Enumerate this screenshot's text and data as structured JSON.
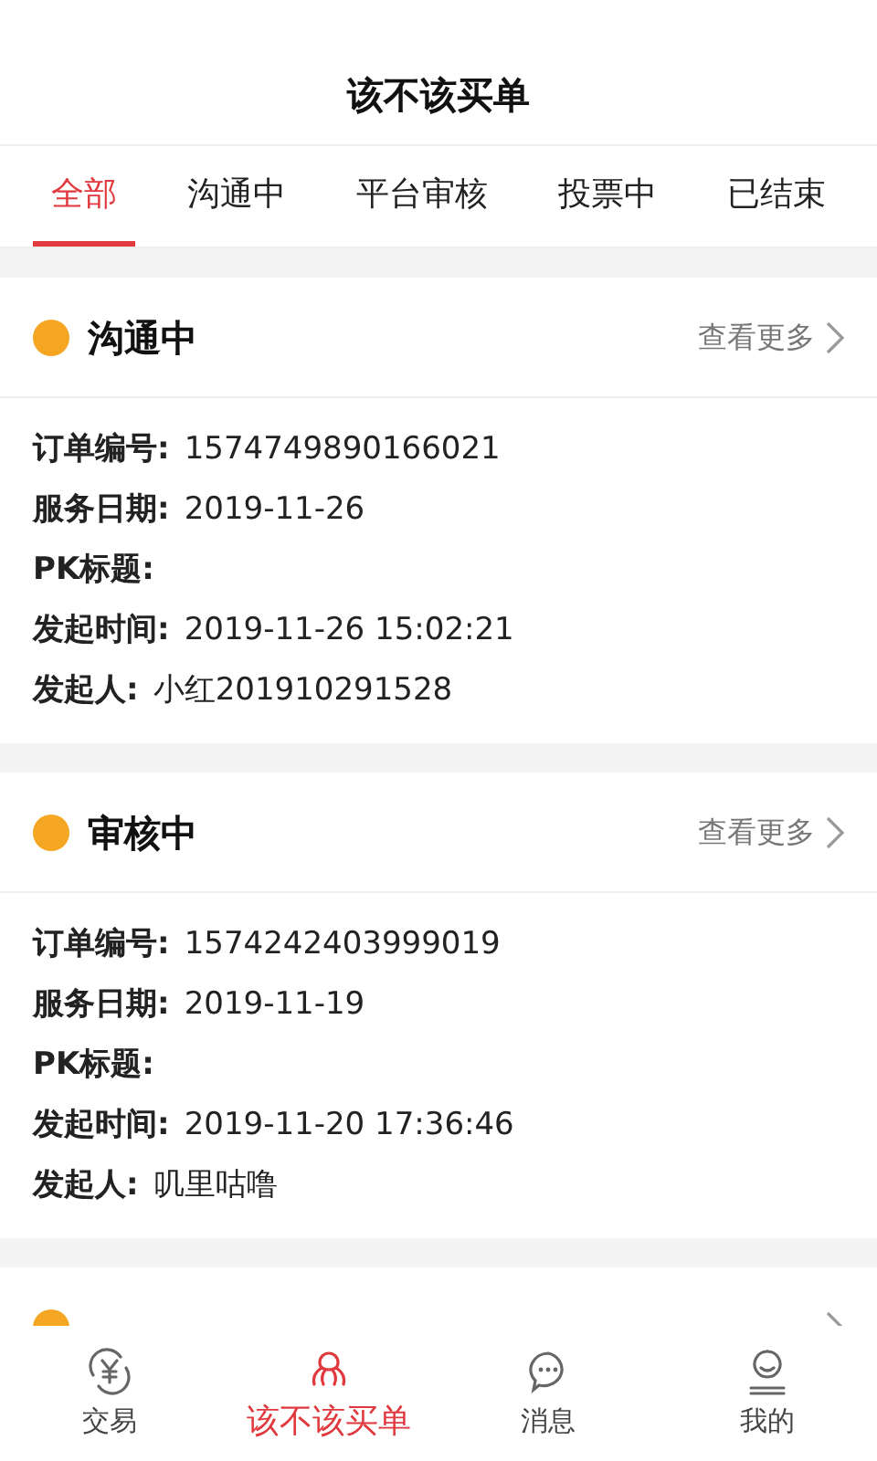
{
  "header": {
    "title": "该不该买单"
  },
  "tabs": [
    {
      "label": "全部",
      "selected": true
    },
    {
      "label": "沟通中",
      "selected": false
    },
    {
      "label": "平台审核",
      "selected": false
    },
    {
      "label": "投票中",
      "selected": false
    },
    {
      "label": "已结束",
      "selected": false
    }
  ],
  "cards": [
    {
      "status": "沟通中",
      "color": "#f5a623",
      "more": "查看更多",
      "fields": [
        {
          "label": "订单编号:",
          "value": "1574749890166021"
        },
        {
          "label": "服务日期:",
          "value": "2019-11-26"
        },
        {
          "label": "PK标题:"
        },
        {
          "label": "发起时间:",
          "value": "2019-11-26 15:02:21"
        },
        {
          "label": "发起人:",
          "value": "小红201910291528"
        }
      ]
    },
    {
      "status": "审核中",
      "color": "#f5a623",
      "more": "查看更多",
      "fields": [
        {
          "label": "订单编号:",
          "value": "1574242403999019"
        },
        {
          "label": "服务日期:",
          "value": "2019-11-19"
        },
        {
          "label": "PK标题:"
        },
        {
          "label": "发起时间:",
          "value": "2019-11-20 17:36:46"
        },
        {
          "label": "发起人:",
          "value": "叽里咕噜"
        }
      ]
    },
    {
      "color": "#f5a623"
    }
  ],
  "nav": [
    {
      "label": "交易",
      "selected": false
    },
    {
      "label": "该不该买单",
      "selected": true
    },
    {
      "label": "消息",
      "selected": false
    },
    {
      "label": "我的",
      "selected": false
    }
  ]
}
